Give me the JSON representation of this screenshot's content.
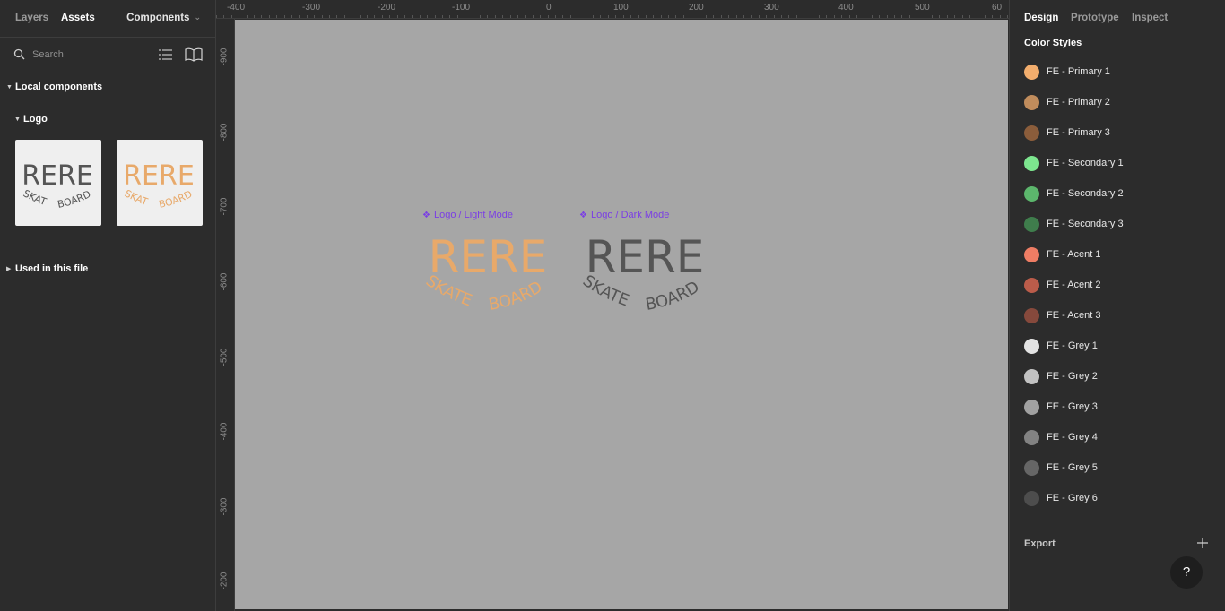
{
  "left_panel": {
    "tabs": [
      {
        "label": "Layers",
        "active": false
      },
      {
        "label": "Assets",
        "active": true
      }
    ],
    "components_dropdown": "Components",
    "search": {
      "placeholder": "Search",
      "value": ""
    },
    "local_components": "Local components",
    "logo_group": "Logo",
    "used_in_file": "Used in this file"
  },
  "logo": {
    "word": "RERE",
    "skate": "SKATE",
    "board": "BOARD"
  },
  "canvas": {
    "frames": [
      {
        "label": "Logo / Light Mode",
        "color": "#e8a96a"
      },
      {
        "label": "Logo / Dark Mode",
        "color": "#555555"
      }
    ],
    "ruler_top": [
      "-400",
      "-300",
      "-200",
      "-100",
      "0",
      "100",
      "200",
      "300",
      "400",
      "500",
      "60"
    ],
    "ruler_left": [
      "-900",
      "-800",
      "-700",
      "-600",
      "-500",
      "-400",
      "-300",
      "-200"
    ]
  },
  "right_panel": {
    "tabs": [
      {
        "label": "Design",
        "active": true
      },
      {
        "label": "Prototype",
        "active": false
      },
      {
        "label": "Inspect",
        "active": false
      }
    ],
    "color_styles_title": "Color Styles",
    "colors": [
      {
        "name": "FE - Primary 1",
        "hex": "#f2ad6d"
      },
      {
        "name": "FE - Primary 2",
        "hex": "#c08c5c"
      },
      {
        "name": "FE - Primary 3",
        "hex": "#8b5d3b"
      },
      {
        "name": "FE - Secondary 1",
        "hex": "#7de68f"
      },
      {
        "name": "FE - Secondary 2",
        "hex": "#5cb66c"
      },
      {
        "name": "FE - Secondary 3",
        "hex": "#3f7d4c"
      },
      {
        "name": "FE - Acent 1",
        "hex": "#ee7d64"
      },
      {
        "name": "FE - Acent 2",
        "hex": "#bb5c4a"
      },
      {
        "name": "FE - Acent 3",
        "hex": "#86493c"
      },
      {
        "name": "FE - Grey 1",
        "hex": "#e3e3e3"
      },
      {
        "name": "FE - Grey 2",
        "hex": "#c2c2c2"
      },
      {
        "name": "FE - Grey 3",
        "hex": "#a1a1a1"
      },
      {
        "name": "FE - Grey 4",
        "hex": "#828282"
      },
      {
        "name": "FE - Grey 5",
        "hex": "#666666"
      },
      {
        "name": "FE - Grey 6",
        "hex": "#4d4d4d"
      }
    ],
    "export_label": "Export",
    "help": "?"
  }
}
